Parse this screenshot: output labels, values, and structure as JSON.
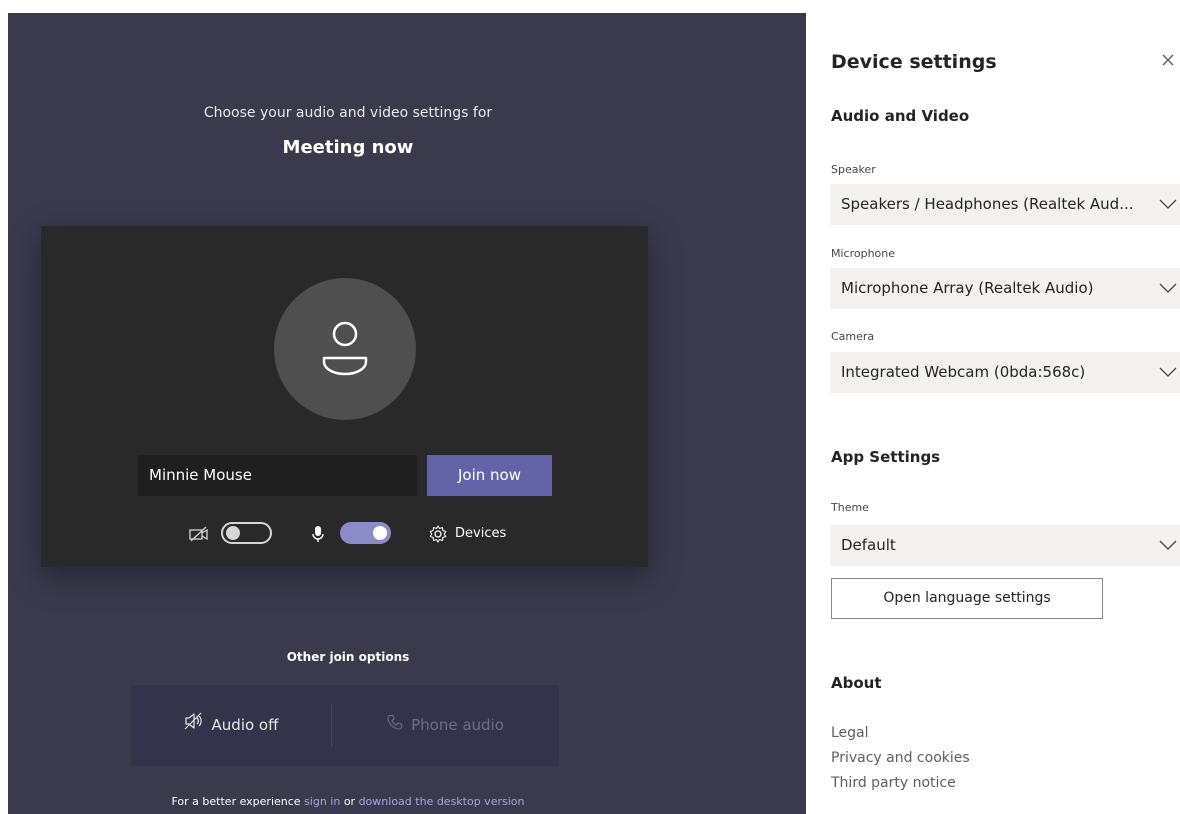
{
  "prejoin": {
    "prompt": "Choose your audio and video settings for",
    "meeting_title": "Meeting now",
    "name_value": "Minnie Mouse",
    "join_label": "Join now",
    "camera_toggle": "off",
    "mic_toggle": "on",
    "devices_label": "Devices",
    "other_options_label": "Other join options",
    "audio_off_label": "Audio off",
    "phone_audio_label": "Phone audio",
    "footer": {
      "prefix": "For a better experience ",
      "sign_in": "sign in",
      "middle": " or ",
      "download": "download the desktop version"
    }
  },
  "settings": {
    "title": "Device settings",
    "audio_video_heading": "Audio and Video",
    "speaker_label": "Speaker",
    "speaker_value": "Speakers / Headphones (Realtek Aud...",
    "microphone_label": "Microphone",
    "microphone_value": "Microphone Array (Realtek Audio)",
    "camera_label": "Camera",
    "camera_value": "Integrated Webcam (0bda:568c)",
    "app_settings_heading": "App Settings",
    "theme_label": "Theme",
    "theme_value": "Default",
    "language_button": "Open language settings",
    "about_heading": "About",
    "about_links": [
      "Legal",
      "Privacy and cookies",
      "Third party notice"
    ]
  },
  "colors": {
    "accent": "#6264a7",
    "stage_background": "#3b3a4d",
    "preview_background": "#292929",
    "toggle_on": "#8b8cc7",
    "link": "#a6a7dc"
  },
  "icons": {
    "close": "close-icon",
    "camera_off": "camera-off-icon",
    "microphone": "microphone-icon",
    "devices": "gear-icon",
    "speaker_off": "speaker-off-icon",
    "phone": "phone-icon",
    "chevron": "chevron-down-icon",
    "avatar": "person-icon"
  }
}
